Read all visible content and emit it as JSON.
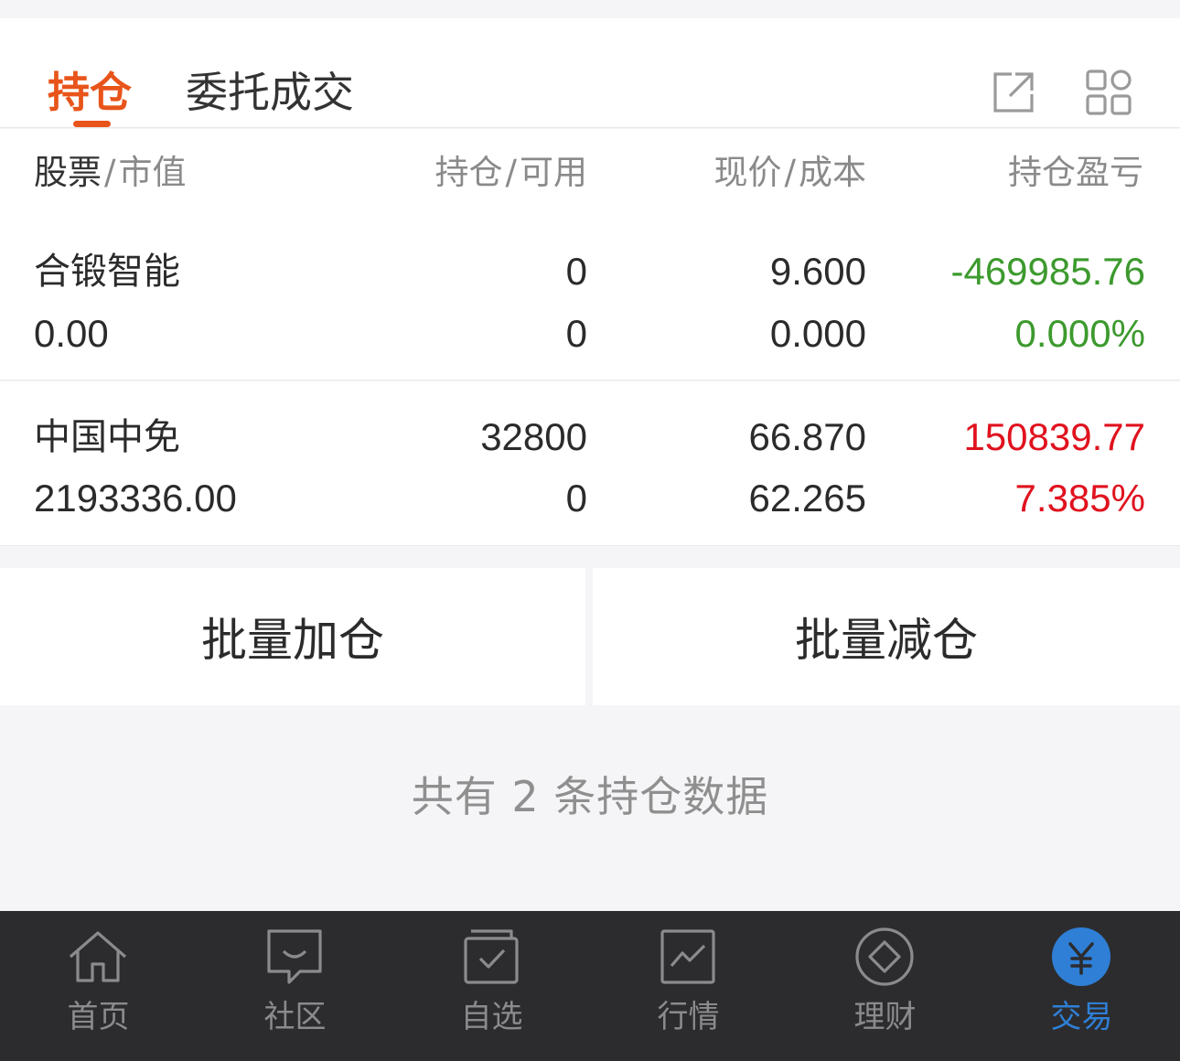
{
  "tabs": {
    "active": "持仓",
    "inactive": "委托成交",
    "share_icon": "external-share-icon",
    "grid_icon": "app-grid-icon"
  },
  "columns": {
    "stock": "股票",
    "market_value": "市值",
    "position": "持仓",
    "available": "可用",
    "price": "现价",
    "cost": "成本",
    "pnl": "持仓盈亏"
  },
  "holdings": [
    {
      "name": "合锻智能",
      "market_value": "0.00",
      "position": "0",
      "available": "0",
      "price": "9.600",
      "cost": "0.000",
      "pnl": "-469985.76",
      "pnl_pct": "0.000%"
    },
    {
      "name": "中国中免",
      "market_value": "2193336.00",
      "position": "32800",
      "available": "0",
      "price": "66.870",
      "cost": "62.265",
      "pnl": "150839.77",
      "pnl_pct": "7.385%"
    }
  ],
  "actions": {
    "batch_add": "批量加仓",
    "batch_reduce": "批量减仓"
  },
  "summary": "共有 2 条持仓数据",
  "nav": [
    {
      "label": "首页",
      "icon": "home-icon"
    },
    {
      "label": "社区",
      "icon": "chat-bubble-icon"
    },
    {
      "label": "自选",
      "icon": "watchlist-check-icon"
    },
    {
      "label": "行情",
      "icon": "market-chart-icon"
    },
    {
      "label": "理财",
      "icon": "diamond-circle-icon"
    },
    {
      "label": "交易",
      "icon": "yuan-icon"
    }
  ],
  "colors": {
    "accent": "#e8541a",
    "gain": "#e0121e",
    "loss": "#3c9a2d",
    "nav_active": "#2f7fd6"
  }
}
